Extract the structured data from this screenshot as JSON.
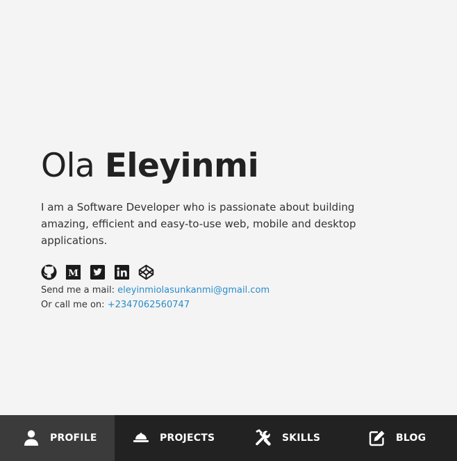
{
  "hero": {
    "first_name": "Ola",
    "last_name": "Eleyinmi",
    "bio": "I am a Software Developer who is passionate about building amazing, efficient and easy-to-use web, mobile and desktop applications.",
    "socials": [
      {
        "icon": "github-icon"
      },
      {
        "icon": "medium-icon"
      },
      {
        "icon": "twitter-icon"
      },
      {
        "icon": "linkedin-icon"
      },
      {
        "icon": "codepen-icon"
      }
    ],
    "mail_label": "Send me a mail: ",
    "mail_value": "eleyinmiolasunkanmi@gmail.com",
    "phone_label": "Or call me on: ",
    "phone_value": "+2347062560747"
  },
  "nav": {
    "items": [
      {
        "label": "PROFILE",
        "icon": "user-icon",
        "active": true
      },
      {
        "label": "PROJECTS",
        "icon": "hard-hat-icon",
        "active": false
      },
      {
        "label": "SKILLS",
        "icon": "tools-icon",
        "active": false
      },
      {
        "label": "BLOG",
        "icon": "edit-icon",
        "active": false
      }
    ]
  },
  "colors": {
    "background": "#f4f4f4",
    "text": "#222222",
    "link": "#2a8cc9",
    "navbar": "#222222",
    "navbar_active": "#3b3b3b"
  }
}
